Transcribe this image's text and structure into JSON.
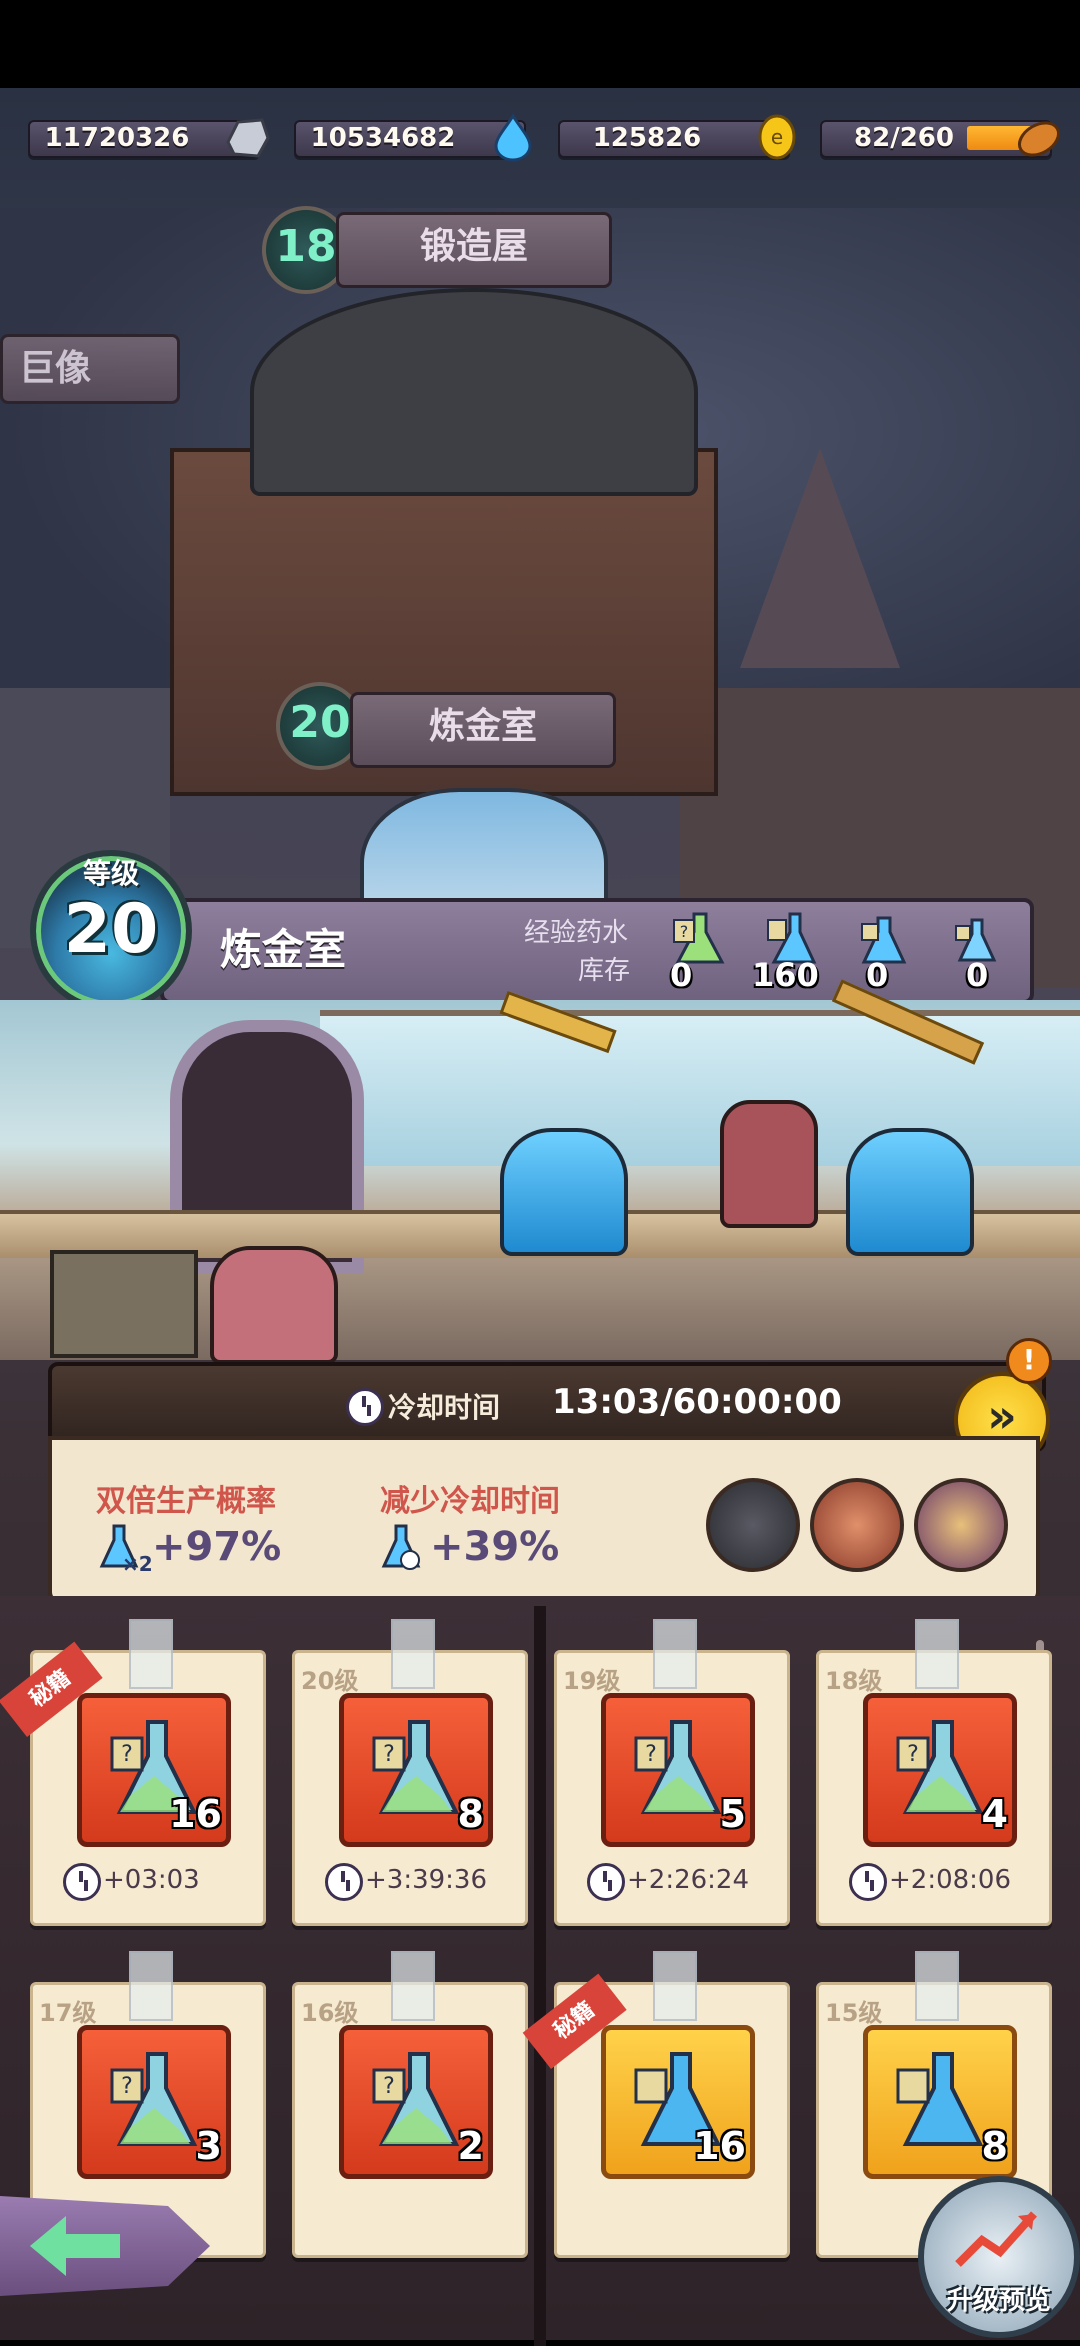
{
  "resources": [
    {
      "value": "11720326",
      "icon": "stone-icon"
    },
    {
      "value": "10534682",
      "icon": "water-drop-icon"
    },
    {
      "value": "125826",
      "icon": "gold-coin-icon"
    },
    {
      "value": "82/260",
      "icon": "bread-icon",
      "fill": 0.315
    }
  ],
  "map": {
    "forge": {
      "level": "18",
      "name": "锻造屋"
    },
    "colossus": {
      "name": "巨像"
    },
    "alchemy": {
      "level": "20",
      "name": "炼金室"
    }
  },
  "info": {
    "level_label": "等级",
    "level": "20",
    "title": "炼金室",
    "stock_label_1": "经验药水",
    "stock_label_2": "库存",
    "potions": [
      {
        "count": "0",
        "icon": "mystery-potion-icon"
      },
      {
        "count": "160",
        "icon": "blue-potion-tag-icon"
      },
      {
        "count": "0",
        "icon": "blue-potion-icon"
      },
      {
        "count": "0",
        "icon": "small-blue-potion-icon"
      }
    ]
  },
  "cooldown": {
    "label": "冷却时间",
    "value": "13:03/60:00:00"
  },
  "stats": {
    "double_label": "双倍生产概率",
    "double_value": "+97%",
    "double_badge": "×2",
    "reduce_label": "减少冷却时间",
    "reduce_value": "+39%"
  },
  "recipes": [
    {
      "tag": "",
      "ribbon": "秘籍",
      "count": "16",
      "time": "+03:03",
      "tile": "red"
    },
    {
      "tag": "20级",
      "ribbon": "",
      "count": "8",
      "time": "+3:39:36",
      "tile": "red"
    },
    {
      "tag": "19级",
      "ribbon": "",
      "count": "5",
      "time": "+2:26:24",
      "tile": "red"
    },
    {
      "tag": "18级",
      "ribbon": "",
      "count": "4",
      "time": "+2:08:06",
      "tile": "red"
    },
    {
      "tag": "17级",
      "ribbon": "",
      "count": "3",
      "time": "",
      "tile": "red"
    },
    {
      "tag": "16级",
      "ribbon": "",
      "count": "2",
      "time": "",
      "tile": "red"
    },
    {
      "tag": "",
      "ribbon": "秘籍",
      "count": "16",
      "time": "",
      "tile": "gold"
    },
    {
      "tag": "15级",
      "ribbon": "",
      "count": "8",
      "time": "",
      "tile": "gold"
    }
  ],
  "footer": {
    "upgrade_preview": "升级预览"
  },
  "colors": {
    "accent_gold": "#f5c518",
    "alert_orange": "#f08a1c",
    "stat_red": "#d0564c"
  }
}
